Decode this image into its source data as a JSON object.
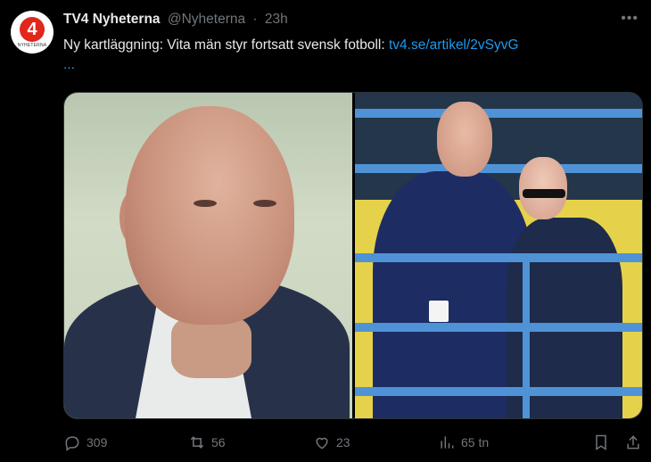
{
  "account": {
    "avatar_number": "4",
    "avatar_text": "NYHETERNA",
    "name": "TV4 Nyheterna",
    "handle": "@Nyheterna",
    "separator": "·",
    "time": "23h"
  },
  "tweet": {
    "text": "Ny kartläggning: Vita män styr fortsatt svensk fotboll:",
    "link": "tv4.se/artikel/2vSyvG",
    "ellipsis": "..."
  },
  "media": {
    "left_image_icon": "portrait-photo-icon",
    "right_image_icon": "football-staff-photo-icon"
  },
  "actions": {
    "replies": "309",
    "reposts": "56",
    "likes": "23",
    "views": "65 tn"
  },
  "icons": {
    "more": "more-icon",
    "reply": "reply-icon",
    "repost": "repost-icon",
    "like": "heart-icon",
    "views": "views-icon",
    "bookmark": "bookmark-icon",
    "share": "share-icon"
  },
  "colors": {
    "background": "#000000",
    "text": "#e7e9ea",
    "muted": "#71767b",
    "link": "#1d9bf0"
  }
}
